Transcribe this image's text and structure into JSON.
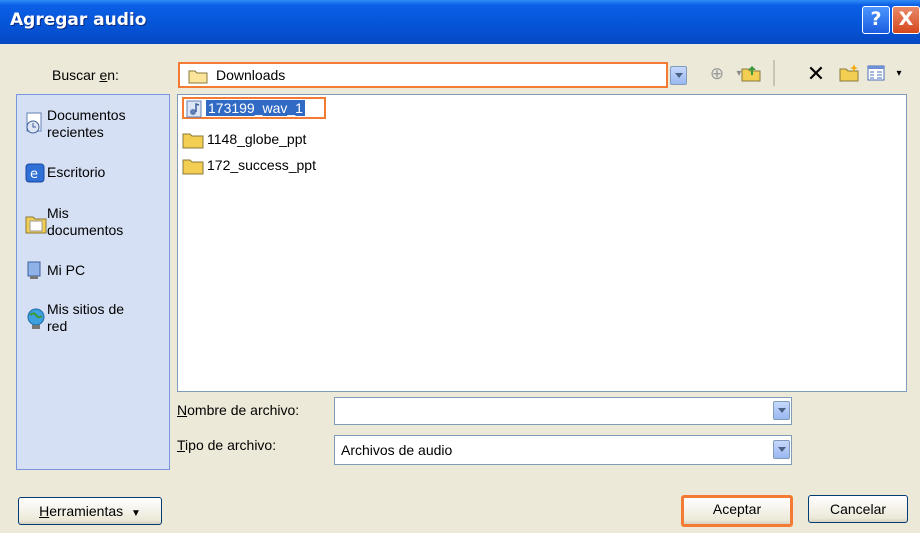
{
  "window": {
    "title": "Agregar audio",
    "help_label": "?",
    "close_label": "X"
  },
  "lookin": {
    "label_pre": "Buscar ",
    "label_ul": "e",
    "label_post": "n:",
    "value": "Downloads"
  },
  "toolbar": {
    "back_icon": "back-arrow-icon",
    "up_icon": "up-folder-icon",
    "delete_icon": "delete-icon",
    "new_folder_icon": "new-folder-icon",
    "views_icon": "views-menu-icon"
  },
  "places": [
    {
      "label": "Documentos\nrecientes",
      "icon": "recent-documents-icon"
    },
    {
      "label": "Escritorio",
      "icon": "desktop-icon"
    },
    {
      "label": "Mis\ndocumentos",
      "icon": "my-documents-icon"
    },
    {
      "label": "Mi PC",
      "icon": "my-computer-icon"
    },
    {
      "label": "Mis sitios de\nred",
      "icon": "network-places-icon"
    }
  ],
  "files": [
    {
      "name": "173199_wav_1",
      "icon": "audio-file-icon",
      "selected": true
    },
    {
      "name": "1148_globe_ppt",
      "icon": "folder-icon",
      "selected": false
    },
    {
      "name": "172_success_ppt",
      "icon": "folder-icon",
      "selected": false
    }
  ],
  "filename": {
    "label_ul": "N",
    "label_post": "ombre de archivo:",
    "value": ""
  },
  "filetype": {
    "label_ul": "T",
    "label_post": "ipo de archivo:",
    "value": "Archivos de audio"
  },
  "buttons": {
    "tools_ul": "H",
    "tools_post": "erramientas",
    "accept": "Aceptar",
    "cancel": "Cancelar"
  },
  "colors": {
    "highlight": "#f47b33",
    "selection": "#316ac5",
    "title_blue": "#0654d6"
  }
}
